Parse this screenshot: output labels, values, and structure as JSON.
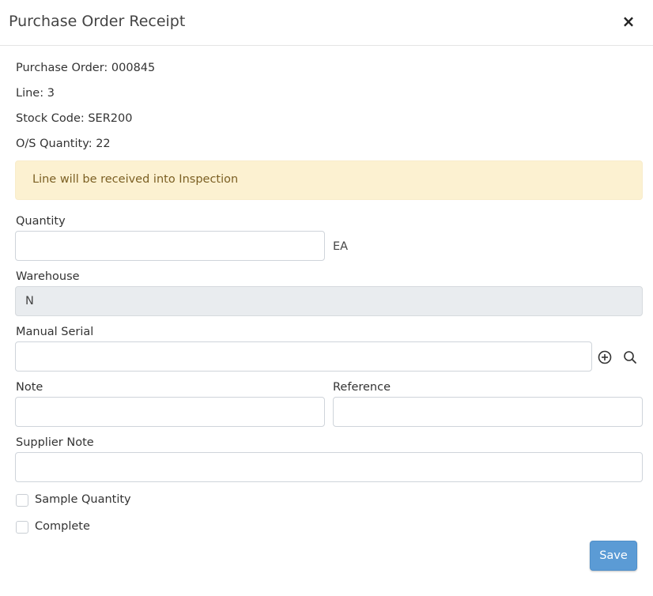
{
  "header": {
    "title": "Purchase Order Receipt",
    "close_label": "×"
  },
  "info": {
    "purchase_order": "Purchase Order: 000845",
    "line": "Line: 3",
    "stock_code": "Stock Code: SER200",
    "os_quantity": "O/S Quantity: 22"
  },
  "alert": {
    "message": "Line will be received into Inspection"
  },
  "form": {
    "quantity_label": "Quantity",
    "quantity_value": "",
    "quantity_unit": "EA",
    "warehouse_label": "Warehouse",
    "warehouse_value": "N",
    "manual_serial_label": "Manual Serial",
    "manual_serial_value": "",
    "note_label": "Note",
    "note_value": "",
    "reference_label": "Reference",
    "reference_value": "",
    "supplier_note_label": "Supplier Note",
    "supplier_note_value": "",
    "sample_quantity_label": "Sample Quantity",
    "sample_quantity_checked": false,
    "complete_label": "Complete",
    "complete_checked": false
  },
  "footer": {
    "save_label": "Save"
  },
  "icons": {
    "add_serial": "plus-circle-icon",
    "search_serial": "search-icon"
  },
  "colors": {
    "alert_bg": "#fcf1d1",
    "alert_text": "#7b5f23",
    "primary_button": "#5b9bd5",
    "readonly_bg": "#e9ecef"
  }
}
